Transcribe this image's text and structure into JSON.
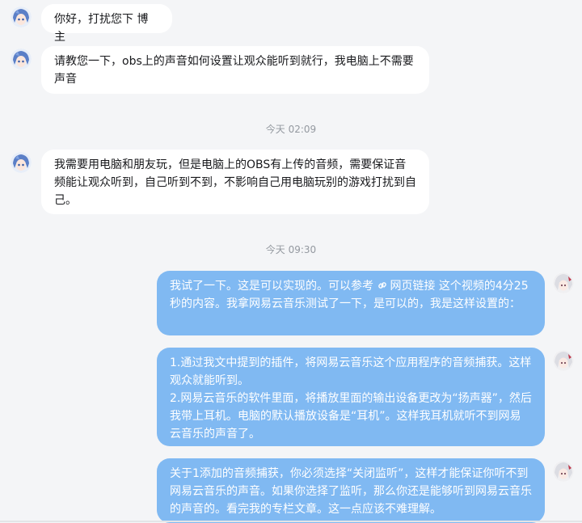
{
  "messages": {
    "m1": {
      "text": "你好，打扰您下 博主"
    },
    "m2": {
      "text": "请教您一下，obs上的声音如何设置让观众能听到就行，我电脑上不需要声音"
    },
    "t1": {
      "time": "今天 02:09"
    },
    "m3": {
      "text": "我需要用电脑和朋友玩，但是电脑上的OBS有上传的音频，需要保证音频能让观众听到，自己听到不到，不影响自己用电脑玩别的游戏打扰到自己。"
    },
    "t2": {
      "time": "今天 09:30"
    },
    "m4": {
      "before": "我试了一下。这是可以实现的。可以参考",
      "link": "网页链接",
      "after": " 这个视频的4分25秒的内容。我拿网易云音乐测试了一下，是可以的，我是这样设置的："
    },
    "m5": {
      "line1": "1.通过我文中提到的插件，将网易云音乐这个应用程序的音频捕获。这样观众就能听到。",
      "line2": "2.网易云音乐的软件里面，将播放里面的输出设备更改为“扬声器”，然后我带上耳机。电脑的默认播放设备是“耳机”。这样我耳机就听不到网易云音乐的声音了。"
    },
    "m6": {
      "text": "关于1添加的音频捕获，你必须选择“关闭监听”，这样才能保证你听不到网易云音乐的声音。如果你选择了监听，那么你还是能够听到网易云音乐的声音的。看完我的专栏文章。这一点应该不难理解。"
    }
  },
  "colors": {
    "bubble_right": "#80b9f2",
    "bubble_left": "#ffffff",
    "background": "#f4f5f7"
  },
  "icons": {
    "link": "link-icon",
    "other_avatar": "anime-avatar-blue",
    "self_avatar": "anime-avatar-white"
  }
}
